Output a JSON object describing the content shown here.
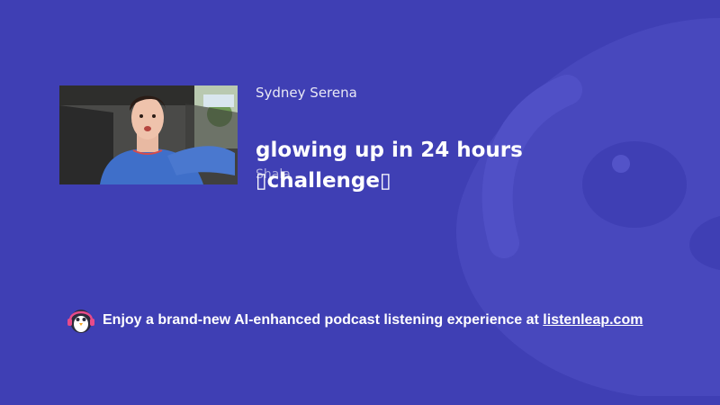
{
  "episode": {
    "author": "Sydney Serena",
    "title": "glowing up in 24 hours ▯challenge▯",
    "subtitle": "Shala"
  },
  "footer": {
    "promo_text": "Enjoy a brand-new AI-enhanced podcast listening experience at ",
    "link_text": "listenleap.com"
  },
  "icons": {
    "logo": "penguin-headphones-icon",
    "background": "mascot-watermark-icon"
  },
  "colors": {
    "background": "#3f3fb4",
    "watermark": "#4c4cc0",
    "text": "#ffffff"
  }
}
